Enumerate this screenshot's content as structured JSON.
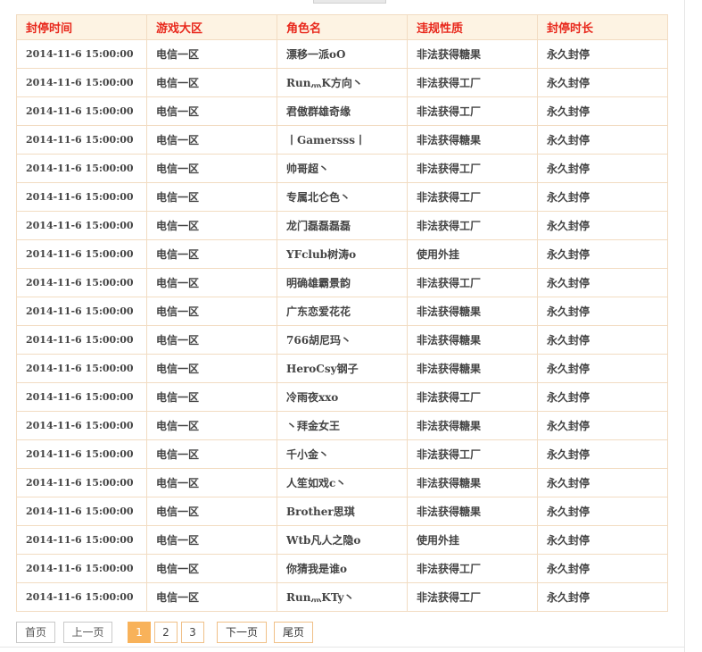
{
  "table": {
    "headers": [
      "封停时间",
      "游戏大区",
      "角色名",
      "违规性质",
      "封停时长"
    ],
    "rows": [
      [
        "2014-11-6 15:00:00",
        "电信一区",
        "漂移一派oO",
        "非法获得糖果",
        "永久封停"
      ],
      [
        "2014-11-6 15:00:00",
        "电信一区",
        "Run灬K方向丶",
        "非法获得工厂",
        "永久封停"
      ],
      [
        "2014-11-6 15:00:00",
        "电信一区",
        "君傲群雄奇缘",
        "非法获得工厂",
        "永久封停"
      ],
      [
        "2014-11-6 15:00:00",
        "电信一区",
        "丨Gamersss丨",
        "非法获得糖果",
        "永久封停"
      ],
      [
        "2014-11-6 15:00:00",
        "电信一区",
        "帅哥超丶",
        "非法获得工厂",
        "永久封停"
      ],
      [
        "2014-11-6 15:00:00",
        "电信一区",
        "专属北仑色丶",
        "非法获得工厂",
        "永久封停"
      ],
      [
        "2014-11-6 15:00:00",
        "电信一区",
        "龙门磊磊磊磊",
        "非法获得工厂",
        "永久封停"
      ],
      [
        "2014-11-6 15:00:00",
        "电信一区",
        "YFclub树涛o",
        "使用外挂",
        "永久封停"
      ],
      [
        "2014-11-6 15:00:00",
        "电信一区",
        "明确雄霸景韵",
        "非法获得工厂",
        "永久封停"
      ],
      [
        "2014-11-6 15:00:00",
        "电信一区",
        "广东恋爱花花",
        "非法获得糖果",
        "永久封停"
      ],
      [
        "2014-11-6 15:00:00",
        "电信一区",
        "766胡尼玛丶",
        "非法获得糖果",
        "永久封停"
      ],
      [
        "2014-11-6 15:00:00",
        "电信一区",
        "HeroCsy钢子",
        "非法获得糖果",
        "永久封停"
      ],
      [
        "2014-11-6 15:00:00",
        "电信一区",
        "冷雨夜xxo",
        "非法获得工厂",
        "永久封停"
      ],
      [
        "2014-11-6 15:00:00",
        "电信一区",
        "丶拜金女王",
        "非法获得糖果",
        "永久封停"
      ],
      [
        "2014-11-6 15:00:00",
        "电信一区",
        "千小金丶",
        "非法获得工厂",
        "永久封停"
      ],
      [
        "2014-11-6 15:00:00",
        "电信一区",
        "人笙如戏c丶",
        "非法获得糖果",
        "永久封停"
      ],
      [
        "2014-11-6 15:00:00",
        "电信一区",
        "Brother思琪",
        "非法获得糖果",
        "永久封停"
      ],
      [
        "2014-11-6 15:00:00",
        "电信一区",
        "Wtb凡人之隐o",
        "使用外挂",
        "永久封停"
      ],
      [
        "2014-11-6 15:00:00",
        "电信一区",
        "你猜我是谁o",
        "非法获得工厂",
        "永久封停"
      ],
      [
        "2014-11-6 15:00:00",
        "电信一区",
        "Run灬KTy丶",
        "非法获得工厂",
        "永久封停"
      ]
    ]
  },
  "pagination": {
    "first": "首页",
    "prev": "上一页",
    "pages": [
      "1",
      "2",
      "3"
    ],
    "current": "1",
    "next": "下一页",
    "last": "尾页"
  },
  "colors": {
    "header_bg": "#fdf3e3",
    "header_text": "#e8281c",
    "border": "#f2dcc2",
    "active_page": "#f8b25a"
  }
}
